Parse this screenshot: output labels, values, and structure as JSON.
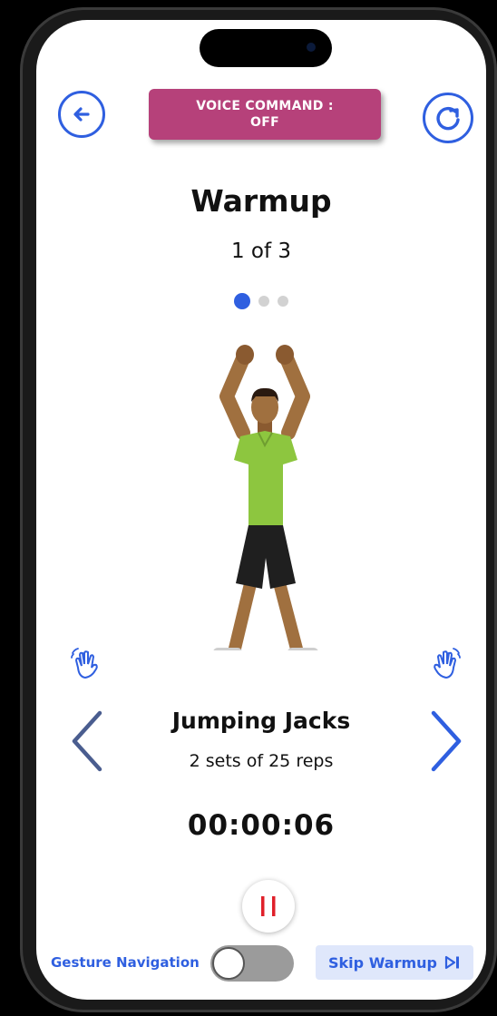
{
  "header": {
    "voice_command_line1": "VOICE COMMAND :",
    "voice_command_line2": "OFF"
  },
  "workout": {
    "title": "Warmup",
    "progress": "1 of 3",
    "total_steps": 3,
    "current_step": 1
  },
  "exercise": {
    "name": "Jumping Jacks",
    "sets": "2 sets of 25 reps",
    "timer": "00:00:06"
  },
  "footer": {
    "gesture_label": "Gesture Navigation",
    "gesture_toggle_on": false,
    "skip_label": "Skip Warmup"
  },
  "icons": {
    "back": "arrow-left-icon",
    "refresh": "refresh-icon",
    "prev": "chevron-left-icon",
    "next": "chevron-right-icon",
    "pause": "pause-icon",
    "hand_left": "wave-hand-icon",
    "hand_right": "wave-hand-icon",
    "skip": "skip-forward-icon"
  },
  "colors": {
    "accent": "#2f5fe0",
    "voice_badge": "#b6417a",
    "pause": "#e0202a",
    "shirt": "#8dc63f"
  }
}
